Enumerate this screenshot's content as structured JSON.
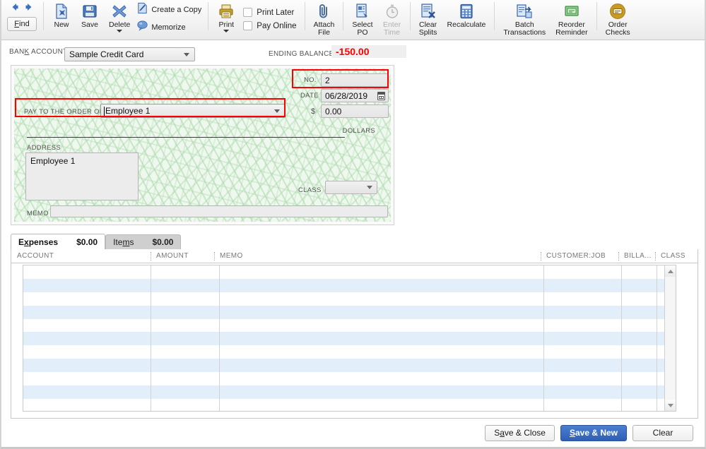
{
  "toolbar": {
    "find_label": "Find",
    "nav_back": "back-arrow",
    "nav_fwd": "forward-arrow",
    "new_label": "New",
    "save_label": "Save",
    "delete_label": "Delete",
    "create_copy_label": "Create a Copy",
    "memorize_label": "Memorize",
    "print_label": "Print",
    "print_later_label": "Print Later",
    "pay_online_label": "Pay Online",
    "attach_file_label": "Attach\nFile",
    "select_po_label": "Select\nPO",
    "enter_time_label": "Enter\nTime",
    "clear_splits_label": "Clear\nSplits",
    "recalculate_label": "Recalculate",
    "batch_transactions_label": "Batch\nTransactions",
    "reorder_reminder_label": "Reorder\nReminder",
    "order_checks_label": "Order\nChecks"
  },
  "account_bar": {
    "bank_account_label": "BANK ACCOUNT",
    "bank_account_value": "Sample Credit Card",
    "ending_balance_label": "ENDING BALANCE",
    "ending_balance_value": "-150.00",
    "ending_balance_color": "#ff0000"
  },
  "check": {
    "no_label": "NO.",
    "no_value": "2",
    "date_label": "DATE",
    "date_value": "06/28/2019",
    "amount_symbol": "$",
    "amount_value": "0.00",
    "pay_to_label": "PAY TO THE ORDER OF",
    "pay_to_value": "Employee 1",
    "dollars_label": "DOLLARS",
    "address_label": "ADDRESS",
    "address_value": "Employee 1",
    "class_label": "CLASS",
    "class_value": "",
    "memo_label": "MEMO",
    "memo_value": "",
    "highlight_color": "#ff0000"
  },
  "tabs": [
    {
      "name": "Expenses",
      "amount": "$0.00",
      "active": true
    },
    {
      "name": "Items",
      "amount": "$0.00",
      "active": false
    }
  ],
  "grid": {
    "columns": [
      "ACCOUNT",
      "AMOUNT",
      "MEMO",
      "CUSTOMER:JOB",
      "BILLA...",
      "CLASS"
    ],
    "rows": [
      [],
      [],
      [],
      [],
      [],
      [],
      [],
      [],
      [],
      [],
      []
    ]
  },
  "footer": {
    "save_close_label": "Save & Close",
    "save_new_label": "Save & New",
    "clear_label": "Clear",
    "primary_color": "#2f5fb5"
  }
}
